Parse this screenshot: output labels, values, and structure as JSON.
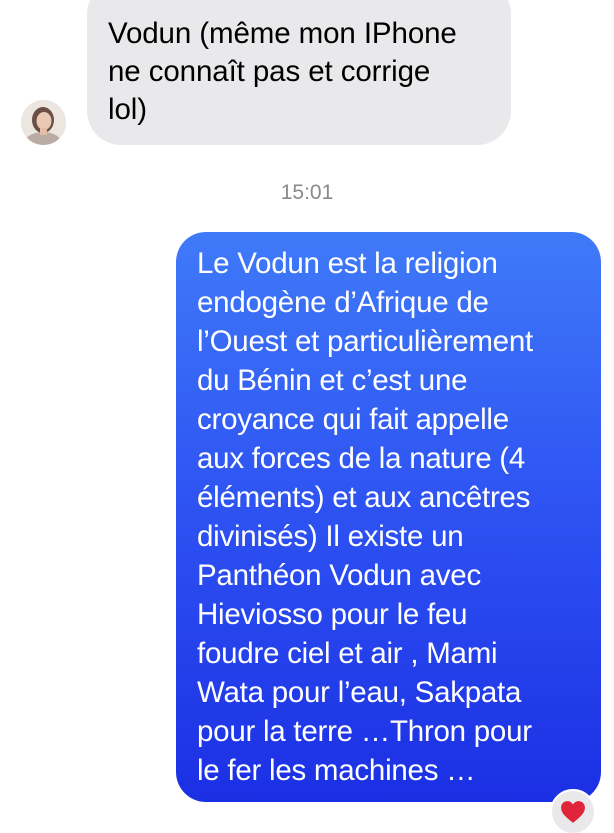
{
  "conversation": {
    "incoming": {
      "lines": [
        "Vodun (même mon IPhone",
        "ne connaît pas et corrige",
        "lol)"
      ]
    },
    "timestamp": "15:01",
    "outgoing": {
      "lines": [
        "Le Vodun est la religion",
        "endogène d’Afrique de",
        "l’Ouest et particulièrement",
        "du Bénin et c’est une",
        "croyance qui fait appelle",
        "aux forces de la nature (4",
        "éléments) et aux ancêtres",
        "divinisés) Il existe un",
        "Panthéon Vodun avec",
        "Hieviosso pour le feu",
        "foudre ciel et air , Mami",
        "Wata pour l’eau, Sakpata",
        "pour la terre …Thron pour",
        "le fer les machines …"
      ]
    },
    "reaction": {
      "icon": "red-heart-icon",
      "color": "#e0243a"
    }
  },
  "colors": {
    "incoming_bubble": "#e9e9eb",
    "outgoing_bubble_top": "#3f7af8",
    "outgoing_bubble_bottom": "#1b2fe4",
    "timestamp_text": "#8a8a8e"
  }
}
